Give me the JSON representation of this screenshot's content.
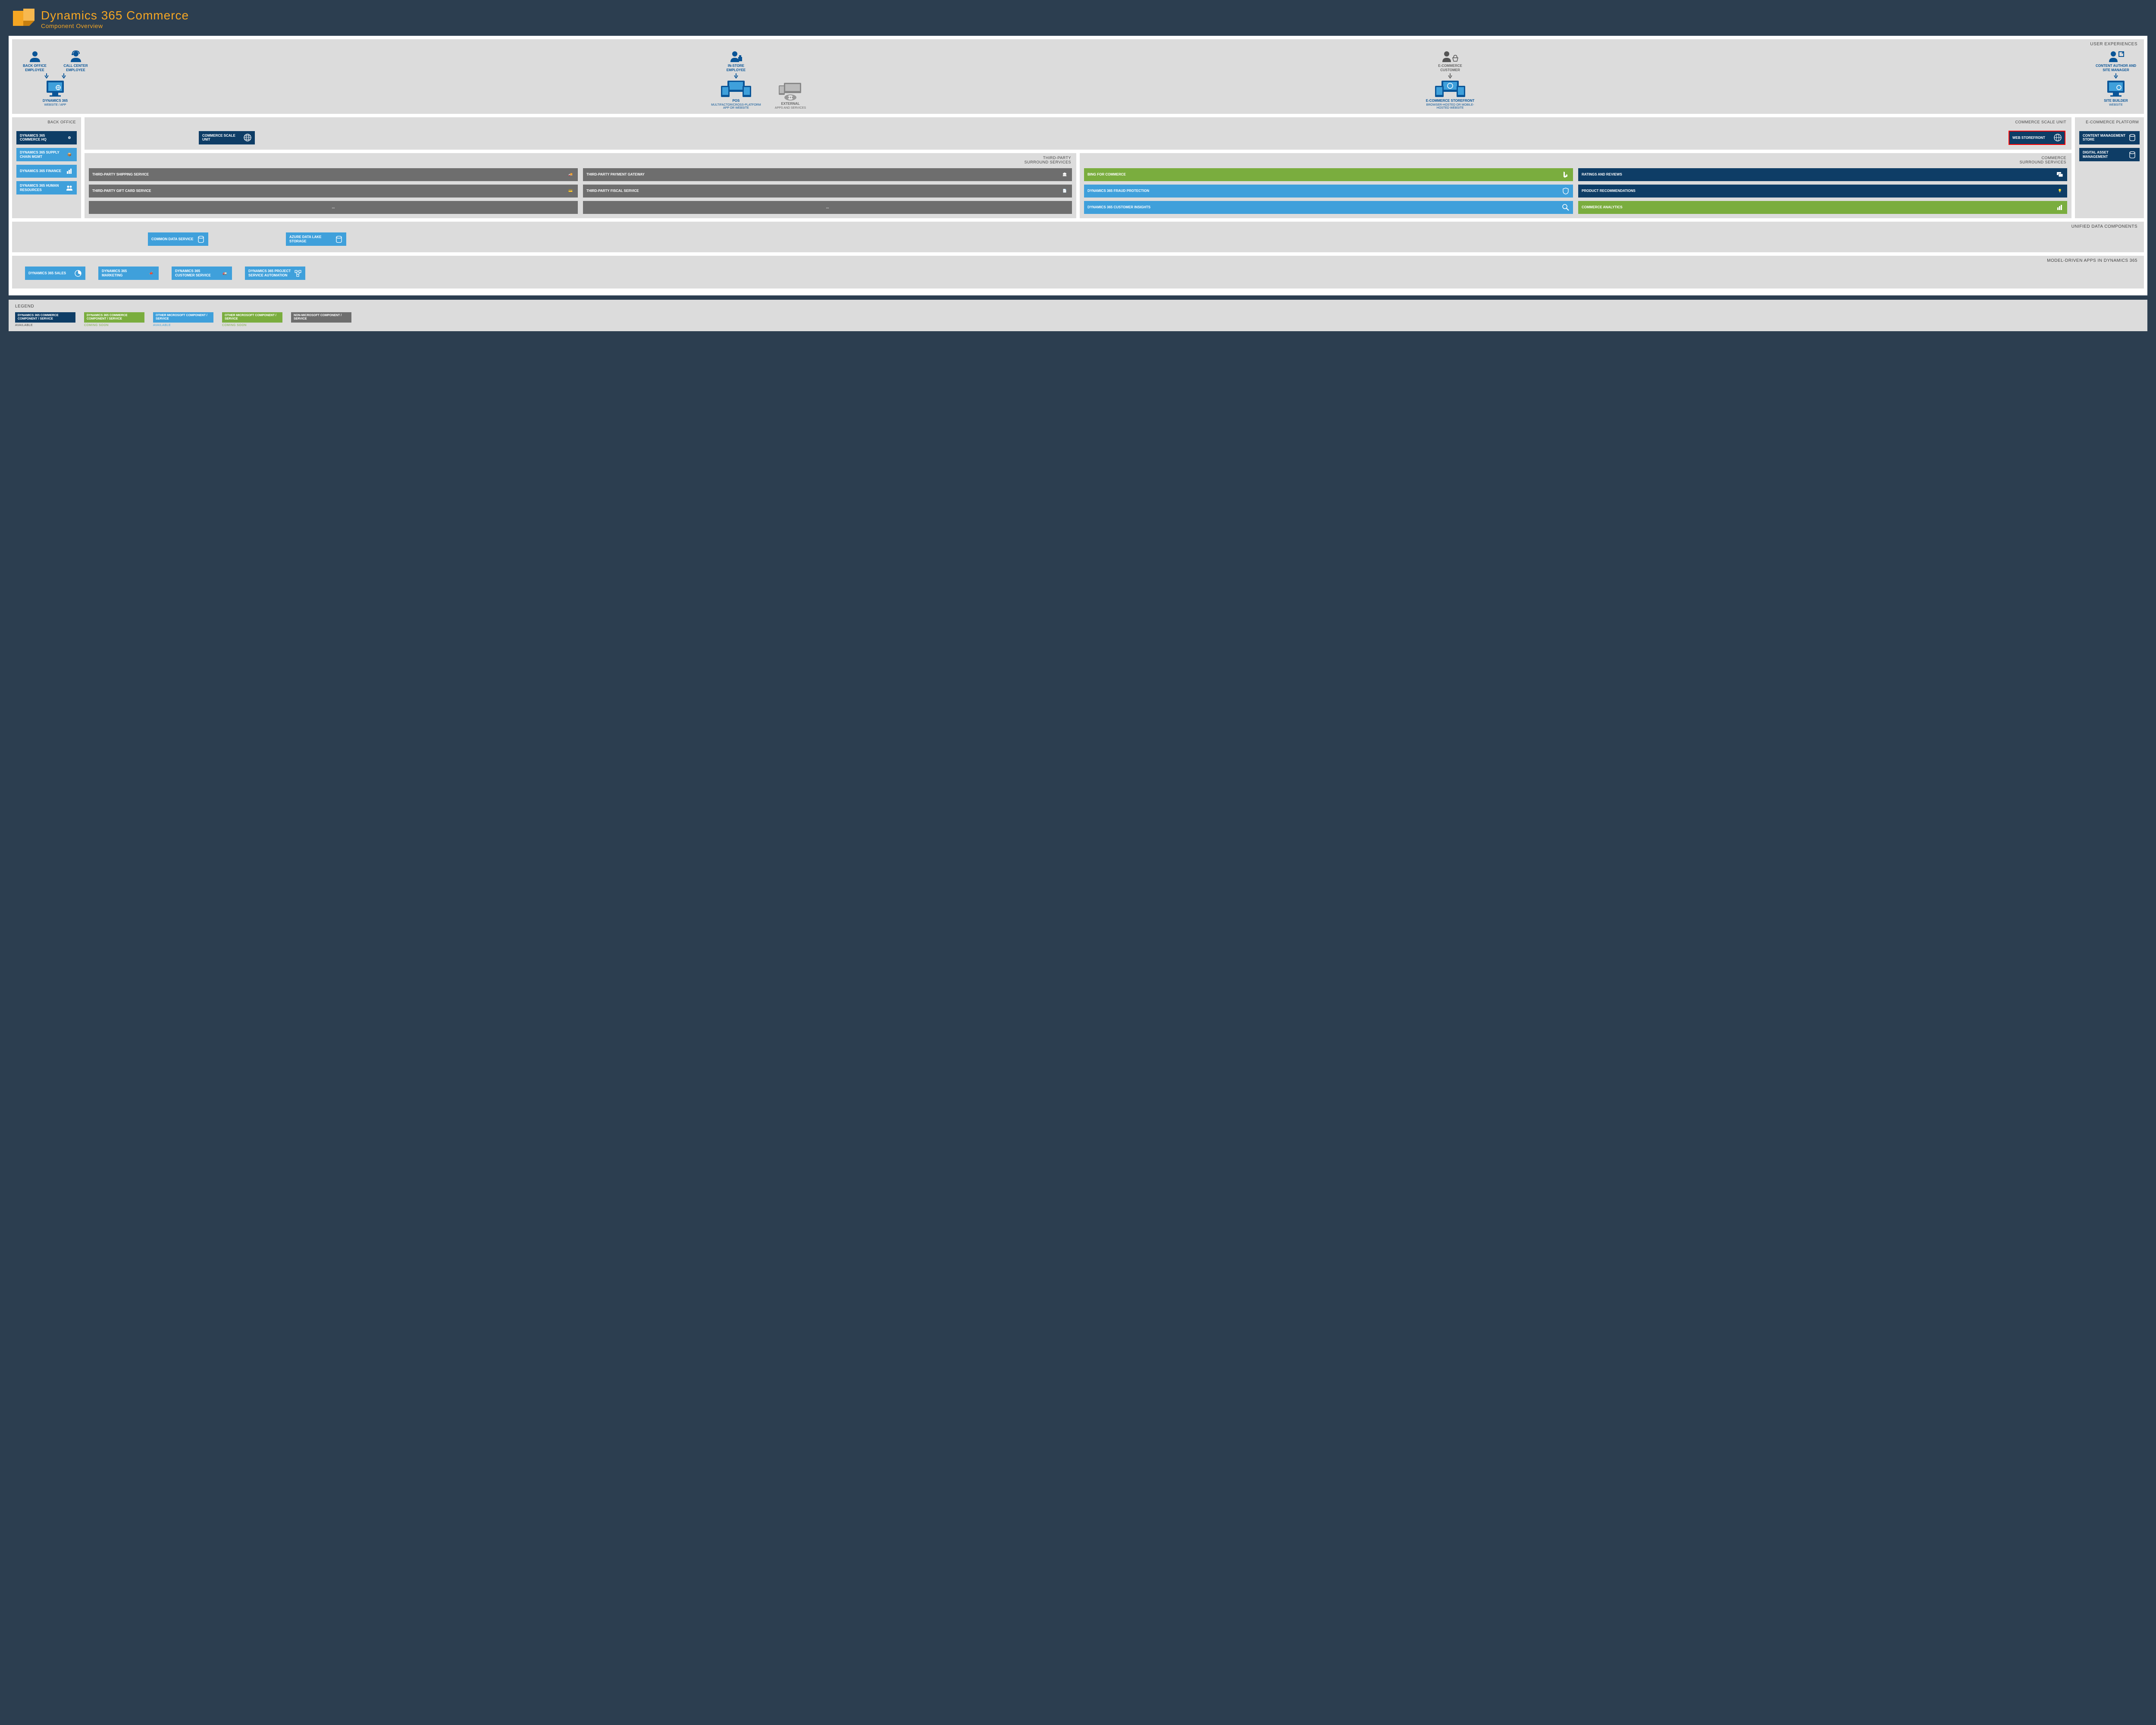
{
  "header": {
    "title": "Dynamics 365 Commerce",
    "subtitle": "Component Overview"
  },
  "sections": {
    "user_experiences": "USER EXPERIENCES",
    "back_office": "BACK OFFICE",
    "commerce_scale": "COMMERCE SCALE UNIT",
    "ecommerce_platform": "E-COMMERCE PLATFORM",
    "third_party": "THIRD-PARTY\nSURROUND SERVICES",
    "commerce_surround": "COMMERCE\nSURROUND SERVICES",
    "unified_data": "UNIFIED DATA COMPONENTS",
    "model_driven": "MODEL-DRIVEN APPS IN DYNAMICS 365"
  },
  "actors": {
    "back_office": "BACK OFFICE EMPLOYEE",
    "call_center": "CALL CENTER EMPLOYEE",
    "in_store": "IN-STORE EMPLOYEE",
    "ecommerce_customer": "E-COMMERCE CUSTOMER",
    "content_author": "CONTENT AUTHOR AND SITE MANAGER"
  },
  "devices": {
    "d365": {
      "name": "DYNAMICS 365",
      "sub": "WEBSITE / APP"
    },
    "pos": {
      "name": "POS",
      "sub": "MULTIFACTOR/CROSS-PLATFORM APP OR WEBSITE"
    },
    "external": {
      "name": "EXTERNAL",
      "sub": "APPS AND SERVICES"
    },
    "storefront": {
      "name": "E-COMMERCE STOREFRONT",
      "sub": "BROWSER-HOSTED OR MOBILE-HOSTED WEBSITE"
    },
    "site_builder": {
      "name": "SITE BUILDER",
      "sub": "WEBSITE"
    }
  },
  "nodes": {
    "commerce_hq": "DYNAMICS 365 COMMERCE HQ",
    "supply_chain": "DYNAMICS 365 SUPPLY CHAIN MGMT",
    "finance": "DYNAMICS 365 FINANCE",
    "hr": "DYNAMICS 365 HUMAN RESOURCES",
    "scale_unit": "COMMERCE SCALE UNIT",
    "web_storefront": "WEB STOREFRONT",
    "content_mgmt": "CONTENT MANAGEMENT STORE",
    "dam": "DIGITAL ASSET MANAGEMENT",
    "shipping": "THIRD-PARTY SHIPPING SERVICE",
    "payment": "THIRD-PARTY PAYMENT GATEWAY",
    "gift_card": "THIRD-PARTY GIFT CARD SERVICE",
    "fiscal": "THIRD-PARTY FISCAL SERVICE",
    "ellipsis": "...",
    "bing": "BING FOR COMMERCE",
    "fraud": "DYNAMICS 365 FRAUD PROTECTION",
    "insights": "DYNAMICS 365 CUSTOMER INSIGHTS",
    "ratings": "RATINGS AND REVIEWS",
    "recommendations": "PRODUCT RECOMMENDATIONS",
    "analytics": "COMMERCE ANALYTICS",
    "cds": "COMMON DATA SERVICE",
    "adls": "AZURE DATA LAKE STORAGE",
    "sales": "DYNAMICS 365 SALES",
    "marketing": "DYNAMICS 365 MARKETING",
    "customer_service": "DYNAMICS 365 CUSTOMER SERVICE",
    "psa": "DYNAMICS 365 PROJECT SERVICE AUTOMATION"
  },
  "legend": {
    "title": "LEGEND",
    "items": [
      {
        "label": "DYNAMICS 365 COMMERCE COMPONENT / SERVICE",
        "status": "AVAILABLE",
        "color": "dark-blue",
        "status_class": "st-dark"
      },
      {
        "label": "DYNAMICS 365 COMMERCE COMPONENT / SERVICE",
        "status": "COMING SOON",
        "color": "green",
        "status_class": "st-green"
      },
      {
        "label": "OTHER MICROSOFT COMPONENT / SERVICE",
        "status": "AVAILABLE",
        "color": "light-blue",
        "status_class": "st-blue"
      },
      {
        "label": "OTHER MICROSOFT COMPONENT / SERVICE",
        "status": "COMING SOON",
        "color": "green",
        "status_class": "st-green"
      },
      {
        "label": "NON-MICROSOFT COMPONENT / SERVICE",
        "status": "",
        "color": "gray-node",
        "status_class": ""
      }
    ]
  }
}
